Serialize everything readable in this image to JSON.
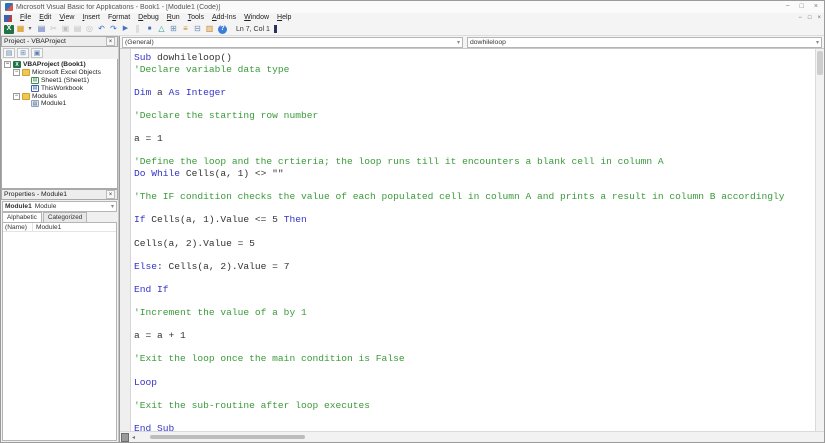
{
  "window": {
    "title": "Microsoft Visual Basic for Applications - Book1 - [Module1 (Code)]",
    "controls": {
      "minimize": "−",
      "maximize": "□",
      "close": "×"
    },
    "child_controls": {
      "minimize": "−",
      "restore": "□",
      "close": "×"
    }
  },
  "menu": {
    "items": [
      {
        "label": "File",
        "accel": 0
      },
      {
        "label": "Edit",
        "accel": 0
      },
      {
        "label": "View",
        "accel": 0
      },
      {
        "label": "Insert",
        "accel": 0
      },
      {
        "label": "Format",
        "accel": 1
      },
      {
        "label": "Debug",
        "accel": 0
      },
      {
        "label": "Run",
        "accel": 0
      },
      {
        "label": "Tools",
        "accel": 0
      },
      {
        "label": "Add-Ins",
        "accel": 0
      },
      {
        "label": "Window",
        "accel": 0
      },
      {
        "label": "Help",
        "accel": 0
      }
    ]
  },
  "toolbar": {
    "position_label": "Ln 7, Col 1",
    "icons": [
      {
        "name": "view-microsoft-excel-icon",
        "glyph": "X",
        "style": "excel"
      },
      {
        "name": "insert-userform-icon",
        "glyph": "▦",
        "style": "form"
      },
      {
        "name": "insert-dropdown-caret-icon",
        "glyph": "▾",
        "style": "caret"
      },
      {
        "name": "save-icon",
        "glyph": "▤",
        "style": "save"
      },
      {
        "name": "cut-icon",
        "glyph": "✂",
        "style": "disabled"
      },
      {
        "name": "copy-icon",
        "glyph": "▣",
        "style": "disabled"
      },
      {
        "name": "paste-icon",
        "glyph": "▤",
        "style": "disabled"
      },
      {
        "name": "find-icon",
        "glyph": "◎",
        "style": "disabled"
      },
      {
        "name": "undo-icon",
        "glyph": "↶",
        "style": "blue"
      },
      {
        "name": "redo-icon",
        "glyph": "↷",
        "style": "blue"
      },
      {
        "name": "run-icon",
        "glyph": "▶",
        "style": "run"
      },
      {
        "name": "break-icon",
        "glyph": "∥",
        "style": "disabled"
      },
      {
        "name": "reset-icon",
        "glyph": "■",
        "style": "reset"
      },
      {
        "name": "design-mode-icon",
        "glyph": "△",
        "style": "teal"
      },
      {
        "name": "project-explorer-icon",
        "glyph": "⊞",
        "style": "mid"
      },
      {
        "name": "properties-window-icon",
        "glyph": "≡",
        "style": "amber"
      },
      {
        "name": "object-browser-icon",
        "glyph": "⊟",
        "style": "mid"
      },
      {
        "name": "toolbox-icon",
        "glyph": "▥",
        "style": "amber"
      },
      {
        "name": "help-icon",
        "glyph": "?",
        "style": "help"
      }
    ]
  },
  "project_panel": {
    "title": "Project - VBAProject",
    "close_glyph": "×",
    "tool_icons": [
      {
        "name": "view-code-icon",
        "glyph": "▤"
      },
      {
        "name": "view-object-icon",
        "glyph": "⊞"
      },
      {
        "name": "toggle-folders-icon",
        "glyph": "▣"
      }
    ],
    "tree": [
      {
        "label": "VBAProject (Book1)",
        "level": 0,
        "bold": true,
        "icon": "excel",
        "expander": "−"
      },
      {
        "label": "Microsoft Excel Objects",
        "level": 1,
        "bold": false,
        "icon": "folder",
        "expander": "−"
      },
      {
        "label": "Sheet1 (Sheet1)",
        "level": 2,
        "bold": false,
        "icon": "sheet",
        "expander": ""
      },
      {
        "label": "ThisWorkbook",
        "level": 2,
        "bold": false,
        "icon": "workbook",
        "expander": ""
      },
      {
        "label": "Modules",
        "level": 1,
        "bold": false,
        "icon": "folder",
        "expander": "−"
      },
      {
        "label": "Module1",
        "level": 2,
        "bold": false,
        "icon": "module",
        "expander": ""
      }
    ]
  },
  "properties_panel": {
    "title": "Properties - Module1",
    "close_glyph": "×",
    "selector_bold": "Module1",
    "selector_rest": "Module",
    "tabs": [
      {
        "label": "Alphabetic",
        "active": true
      },
      {
        "label": "Categorized",
        "active": false
      }
    ],
    "rows": [
      {
        "name": "(Name)",
        "value": "Module1"
      }
    ]
  },
  "code_window": {
    "left_dropdown": "(General)",
    "right_dropdown": "dowhileloop",
    "lines": [
      [
        {
          "t": "kw",
          "s": "Sub"
        },
        {
          "t": "txt",
          "s": " dowhileloop()"
        }
      ],
      [
        {
          "t": "com",
          "s": "'Declare variable data type"
        }
      ],
      [],
      [
        {
          "t": "kw",
          "s": "Dim"
        },
        {
          "t": "txt",
          "s": " a "
        },
        {
          "t": "kw",
          "s": "As"
        },
        {
          "t": "txt",
          "s": " "
        },
        {
          "t": "kw",
          "s": "Integer"
        }
      ],
      [],
      [
        {
          "t": "com",
          "s": "'Declare the starting row number"
        }
      ],
      [],
      [
        {
          "t": "txt",
          "s": "a = 1"
        }
      ],
      [],
      [
        {
          "t": "com",
          "s": "'Define the loop and the crtieria; the loop runs till it encounters a blank cell in column A"
        }
      ],
      [
        {
          "t": "kw",
          "s": "Do While"
        },
        {
          "t": "txt",
          "s": " Cells(a, 1) <> \"\""
        }
      ],
      [],
      [
        {
          "t": "com",
          "s": "'The IF condition checks the value of each populated cell in column A and prints a result in column B accordingly"
        }
      ],
      [],
      [
        {
          "t": "kw",
          "s": "If"
        },
        {
          "t": "txt",
          "s": " Cells(a, 1).Value <= 5 "
        },
        {
          "t": "kw",
          "s": "Then"
        }
      ],
      [],
      [
        {
          "t": "txt",
          "s": "Cells(a, 2).Value = 5"
        }
      ],
      [],
      [
        {
          "t": "kw",
          "s": "Else"
        },
        {
          "t": "txt",
          "s": ": Cells(a, 2).Value = 7"
        }
      ],
      [],
      [
        {
          "t": "kw",
          "s": "End If"
        }
      ],
      [],
      [
        {
          "t": "com",
          "s": "'Increment the value of a by 1"
        }
      ],
      [],
      [
        {
          "t": "txt",
          "s": "a = a + 1"
        }
      ],
      [],
      [
        {
          "t": "com",
          "s": "'Exit the loop once the main condition is False"
        }
      ],
      [],
      [
        {
          "t": "kw",
          "s": "Loop"
        }
      ],
      [],
      [
        {
          "t": "com",
          "s": "'Exit the sub-routine after loop executes"
        }
      ],
      [],
      [
        {
          "t": "kw",
          "s": "End Sub"
        }
      ]
    ]
  },
  "colors": {
    "keyword": "#3434c8",
    "comment": "#3a9b3a",
    "text": "#333333",
    "excel_green": "#217346",
    "help_blue": "#3b7dd8"
  }
}
